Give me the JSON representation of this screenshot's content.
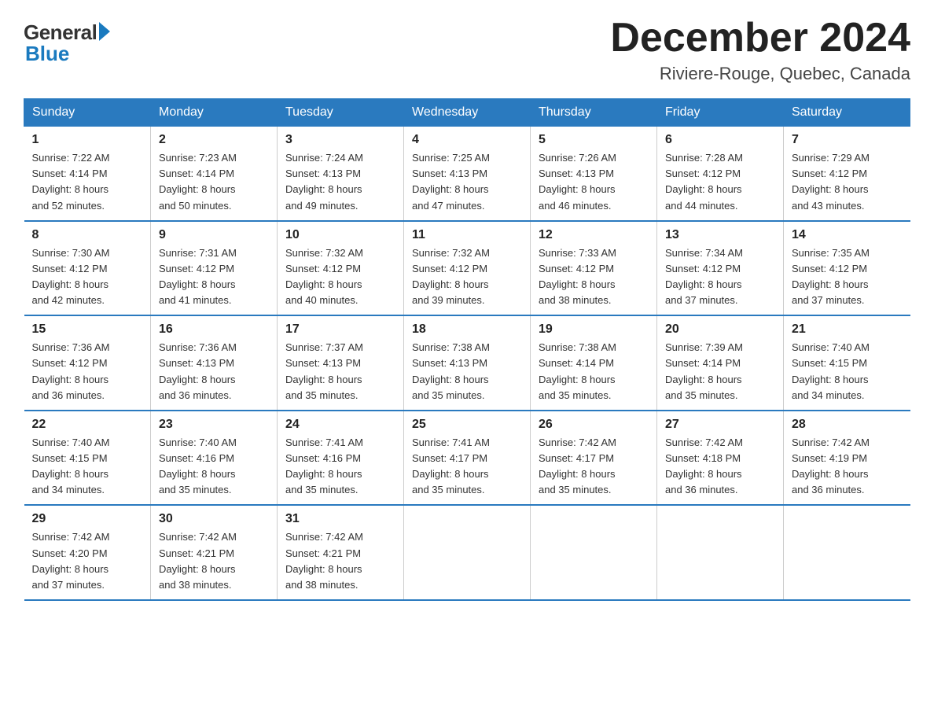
{
  "logo": {
    "general": "General",
    "blue": "Blue"
  },
  "title": "December 2024",
  "location": "Riviere-Rouge, Quebec, Canada",
  "days_of_week": [
    "Sunday",
    "Monday",
    "Tuesday",
    "Wednesday",
    "Thursday",
    "Friday",
    "Saturday"
  ],
  "weeks": [
    [
      {
        "day": "1",
        "sunrise": "7:22 AM",
        "sunset": "4:14 PM",
        "daylight": "8 hours and 52 minutes."
      },
      {
        "day": "2",
        "sunrise": "7:23 AM",
        "sunset": "4:14 PM",
        "daylight": "8 hours and 50 minutes."
      },
      {
        "day": "3",
        "sunrise": "7:24 AM",
        "sunset": "4:13 PM",
        "daylight": "8 hours and 49 minutes."
      },
      {
        "day": "4",
        "sunrise": "7:25 AM",
        "sunset": "4:13 PM",
        "daylight": "8 hours and 47 minutes."
      },
      {
        "day": "5",
        "sunrise": "7:26 AM",
        "sunset": "4:13 PM",
        "daylight": "8 hours and 46 minutes."
      },
      {
        "day": "6",
        "sunrise": "7:28 AM",
        "sunset": "4:12 PM",
        "daylight": "8 hours and 44 minutes."
      },
      {
        "day": "7",
        "sunrise": "7:29 AM",
        "sunset": "4:12 PM",
        "daylight": "8 hours and 43 minutes."
      }
    ],
    [
      {
        "day": "8",
        "sunrise": "7:30 AM",
        "sunset": "4:12 PM",
        "daylight": "8 hours and 42 minutes."
      },
      {
        "day": "9",
        "sunrise": "7:31 AM",
        "sunset": "4:12 PM",
        "daylight": "8 hours and 41 minutes."
      },
      {
        "day": "10",
        "sunrise": "7:32 AM",
        "sunset": "4:12 PM",
        "daylight": "8 hours and 40 minutes."
      },
      {
        "day": "11",
        "sunrise": "7:32 AM",
        "sunset": "4:12 PM",
        "daylight": "8 hours and 39 minutes."
      },
      {
        "day": "12",
        "sunrise": "7:33 AM",
        "sunset": "4:12 PM",
        "daylight": "8 hours and 38 minutes."
      },
      {
        "day": "13",
        "sunrise": "7:34 AM",
        "sunset": "4:12 PM",
        "daylight": "8 hours and 37 minutes."
      },
      {
        "day": "14",
        "sunrise": "7:35 AM",
        "sunset": "4:12 PM",
        "daylight": "8 hours and 37 minutes."
      }
    ],
    [
      {
        "day": "15",
        "sunrise": "7:36 AM",
        "sunset": "4:12 PM",
        "daylight": "8 hours and 36 minutes."
      },
      {
        "day": "16",
        "sunrise": "7:36 AM",
        "sunset": "4:13 PM",
        "daylight": "8 hours and 36 minutes."
      },
      {
        "day": "17",
        "sunrise": "7:37 AM",
        "sunset": "4:13 PM",
        "daylight": "8 hours and 35 minutes."
      },
      {
        "day": "18",
        "sunrise": "7:38 AM",
        "sunset": "4:13 PM",
        "daylight": "8 hours and 35 minutes."
      },
      {
        "day": "19",
        "sunrise": "7:38 AM",
        "sunset": "4:14 PM",
        "daylight": "8 hours and 35 minutes."
      },
      {
        "day": "20",
        "sunrise": "7:39 AM",
        "sunset": "4:14 PM",
        "daylight": "8 hours and 35 minutes."
      },
      {
        "day": "21",
        "sunrise": "7:40 AM",
        "sunset": "4:15 PM",
        "daylight": "8 hours and 34 minutes."
      }
    ],
    [
      {
        "day": "22",
        "sunrise": "7:40 AM",
        "sunset": "4:15 PM",
        "daylight": "8 hours and 34 minutes."
      },
      {
        "day": "23",
        "sunrise": "7:40 AM",
        "sunset": "4:16 PM",
        "daylight": "8 hours and 35 minutes."
      },
      {
        "day": "24",
        "sunrise": "7:41 AM",
        "sunset": "4:16 PM",
        "daylight": "8 hours and 35 minutes."
      },
      {
        "day": "25",
        "sunrise": "7:41 AM",
        "sunset": "4:17 PM",
        "daylight": "8 hours and 35 minutes."
      },
      {
        "day": "26",
        "sunrise": "7:42 AM",
        "sunset": "4:17 PM",
        "daylight": "8 hours and 35 minutes."
      },
      {
        "day": "27",
        "sunrise": "7:42 AM",
        "sunset": "4:18 PM",
        "daylight": "8 hours and 36 minutes."
      },
      {
        "day": "28",
        "sunrise": "7:42 AM",
        "sunset": "4:19 PM",
        "daylight": "8 hours and 36 minutes."
      }
    ],
    [
      {
        "day": "29",
        "sunrise": "7:42 AM",
        "sunset": "4:20 PM",
        "daylight": "8 hours and 37 minutes."
      },
      {
        "day": "30",
        "sunrise": "7:42 AM",
        "sunset": "4:21 PM",
        "daylight": "8 hours and 38 minutes."
      },
      {
        "day": "31",
        "sunrise": "7:42 AM",
        "sunset": "4:21 PM",
        "daylight": "8 hours and 38 minutes."
      },
      null,
      null,
      null,
      null
    ]
  ],
  "labels": {
    "sunrise": "Sunrise:",
    "sunset": "Sunset:",
    "daylight": "Daylight:"
  }
}
